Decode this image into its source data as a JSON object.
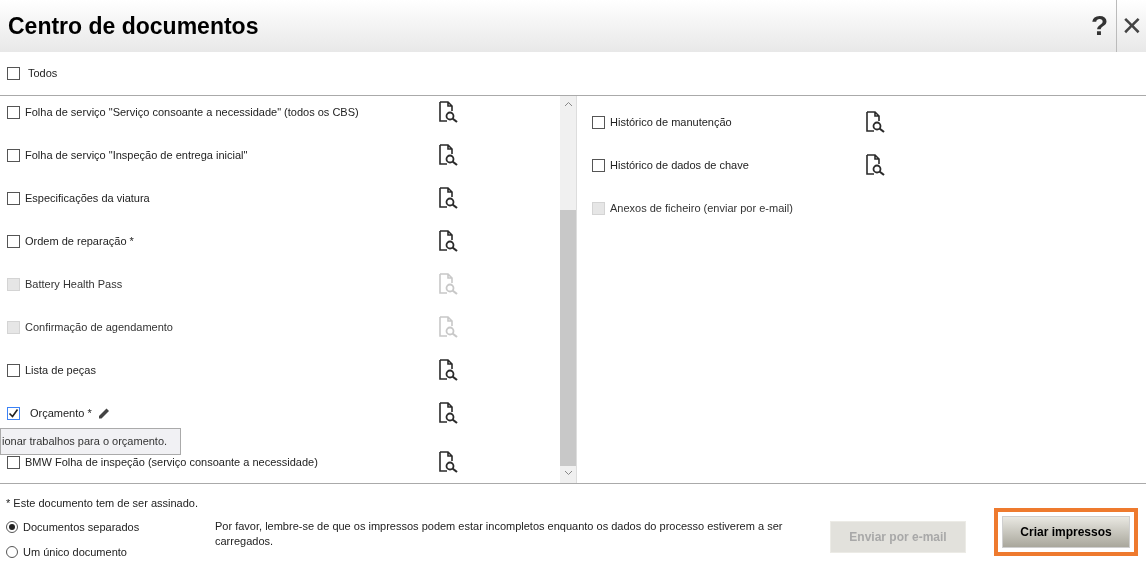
{
  "window": {
    "title": "Centro de documentos",
    "help": "?",
    "close": "✕"
  },
  "select_all": {
    "label": "Todos",
    "checked": false
  },
  "left_documents": [
    {
      "label": "Folha de serviço \"Serviço consoante a necessidade\" (todos os CBS)",
      "checked": false,
      "disabled": false,
      "editable": false,
      "preview": true
    },
    {
      "label": "Folha de serviço \"Inspeção de entrega inicial\"",
      "checked": false,
      "disabled": false,
      "editable": false,
      "preview": true
    },
    {
      "label": "Especificações da viatura",
      "checked": false,
      "disabled": false,
      "editable": false,
      "preview": true
    },
    {
      "label": "Ordem de reparação *",
      "checked": false,
      "disabled": false,
      "editable": false,
      "preview": true
    },
    {
      "label": "Battery Health Pass",
      "checked": false,
      "disabled": true,
      "editable": false,
      "preview": true
    },
    {
      "label": "Confirmação de agendamento",
      "checked": false,
      "disabled": true,
      "editable": false,
      "preview": true
    },
    {
      "label": "Lista de peças",
      "checked": false,
      "disabled": false,
      "editable": false,
      "preview": true
    },
    {
      "label": "Orçamento *",
      "checked": true,
      "disabled": false,
      "editable": true,
      "preview": true
    },
    {
      "label": "BMW Folha de inspeção (serviço consoante a necessidade)",
      "checked": false,
      "disabled": false,
      "editable": false,
      "preview": true
    }
  ],
  "tooltip": "ionar trabalhos para o orçamento.",
  "right_documents": [
    {
      "label": "Histórico de manutenção",
      "checked": false,
      "disabled": false,
      "editable": false,
      "preview": true
    },
    {
      "label": "Histórico de dados de chave",
      "checked": false,
      "disabled": false,
      "editable": false,
      "preview": true
    },
    {
      "label": "Anexos de ficheiro (enviar por e-mail)",
      "checked": false,
      "disabled": true,
      "editable": false,
      "preview": false
    }
  ],
  "footnote": "* Este documento tem de ser assinado.",
  "output_options": [
    {
      "label": "Documentos separados",
      "selected": true
    },
    {
      "label": "Um único documento",
      "selected": false
    }
  ],
  "notice": "Por favor, lembre-se de que os impressos podem estar incompletos enquanto os dados do processo estiverem a ser carregados.",
  "buttons": [
    {
      "label": "Enviar por e-mail",
      "disabled": true,
      "highlighted": false
    },
    {
      "label": "Criar impressos",
      "disabled": false,
      "highlighted": true
    }
  ]
}
